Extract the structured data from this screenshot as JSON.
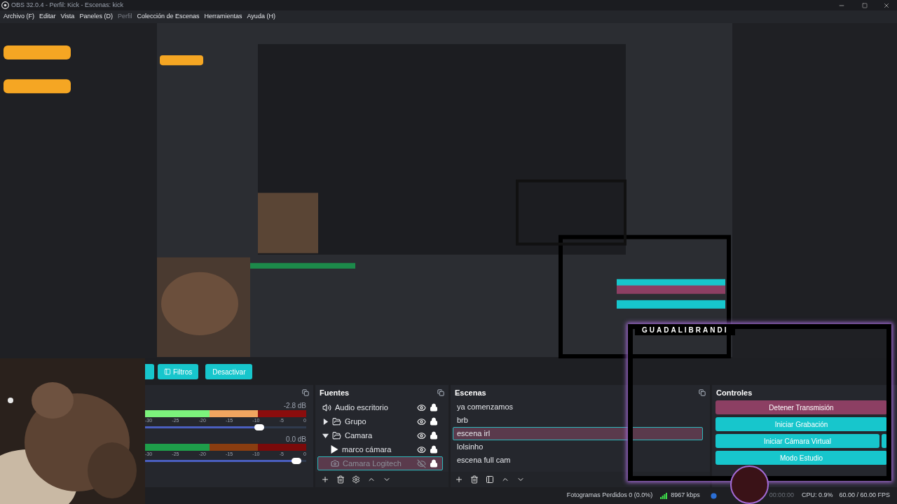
{
  "window": {
    "title": "OBS 32.0.4 - Perfil: Kick - Escenas: kick"
  },
  "menu": [
    {
      "label": "Archivo (F)",
      "disabled": false
    },
    {
      "label": "Editar",
      "disabled": false
    },
    {
      "label": "Vista",
      "disabled": false
    },
    {
      "label": "Paneles (D)",
      "disabled": false
    },
    {
      "label": "Perfil",
      "disabled": true
    },
    {
      "label": "Colección de Escenas",
      "disabled": false
    },
    {
      "label": "Herramientas",
      "disabled": false
    },
    {
      "label": "Ayuda (H)",
      "disabled": false
    }
  ],
  "toolbar": [
    {
      "kind": "partial"
    },
    {
      "kind": "filters",
      "label": "Filtros"
    },
    {
      "kind": "plain",
      "label": "Desactivar"
    }
  ],
  "mixer": {
    "channels": [
      {
        "reading": "-2.8 dB",
        "signal": true,
        "level": 0.74,
        "scale": [
          "-30",
          "-25",
          "-20",
          "-15",
          "-10",
          "-5",
          "0"
        ]
      },
      {
        "reading": "0.0 dB",
        "signal": false,
        "level": 0.97,
        "scale": [
          "-30",
          "-25",
          "-20",
          "-15",
          "-10",
          "-5",
          "0"
        ]
      }
    ]
  },
  "sources": {
    "title": "Fuentes",
    "items": [
      {
        "name": "Audio escritorio",
        "kind": "audio",
        "visible": true,
        "locked": true,
        "selected": false
      },
      {
        "name": "Grupo",
        "kind": "group",
        "expanded": false,
        "visible": true,
        "locked": true,
        "selected": false
      },
      {
        "name": "Camara",
        "kind": "group",
        "expanded": true,
        "visible": true,
        "locked": true,
        "selected": false,
        "children": [
          {
            "name": "marco cámara",
            "kind": "media",
            "visible": true,
            "locked": true,
            "selected": false
          },
          {
            "name": "Camara Logitech",
            "kind": "camera",
            "visible": false,
            "locked": true,
            "selected": true
          }
        ]
      }
    ]
  },
  "scenes": {
    "title": "Escenas",
    "items": [
      {
        "name": "ya comenzamos",
        "selected": false
      },
      {
        "name": "brb",
        "selected": false
      },
      {
        "name": "escena irl",
        "selected": true
      },
      {
        "name": "lolsinho",
        "selected": false
      },
      {
        "name": "escena full cam",
        "selected": false
      }
    ]
  },
  "controls": {
    "title": "Controles",
    "buttons": [
      {
        "label": "Detener Transmisión",
        "kind": "stop"
      },
      {
        "label": "Iniciar Grabación",
        "kind": "start"
      },
      {
        "label": "Iniciar Cámara Virtual",
        "kind": "virtualcam"
      },
      {
        "label": "Modo Estudio",
        "kind": "start"
      }
    ]
  },
  "overlay": {
    "name_tag": "GUADALIBRANDI"
  },
  "status": {
    "dropped": "Fotogramas Perdidos 0 (0.0%)",
    "bitrate": "8967 kbps",
    "rec_time": "00:00:00",
    "cpu": "CPU: 0.9%",
    "fps": "60.00 / 60.00 FPS"
  }
}
